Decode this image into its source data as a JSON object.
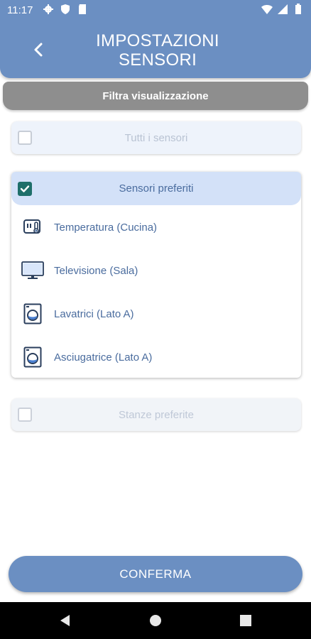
{
  "status_bar": {
    "time": "11:17"
  },
  "header": {
    "title": "IMPOSTAZIONI SENSORI"
  },
  "filter": {
    "label": "Filtra visualizzazione"
  },
  "options": {
    "all_sensors": "Tutti i sensori",
    "favorite_sensors": "Sensori preferiti",
    "favorite_rooms": "Stanze preferite"
  },
  "sensors": [
    {
      "label": "Temperatura (Cucina)",
      "icon": "thermostat-icon"
    },
    {
      "label": "Televisione (Sala)",
      "icon": "tv-icon"
    },
    {
      "label": "Lavatrici (Lato A)",
      "icon": "washing-machine-icon"
    },
    {
      "label": "Asciugatrice (Lato A)",
      "icon": "dryer-icon"
    }
  ],
  "confirm": {
    "label": "CONFERMA"
  },
  "colors": {
    "primary": "#6b8fc2",
    "checkbox": "#1f6f6a",
    "text": "#4a6c9e"
  }
}
